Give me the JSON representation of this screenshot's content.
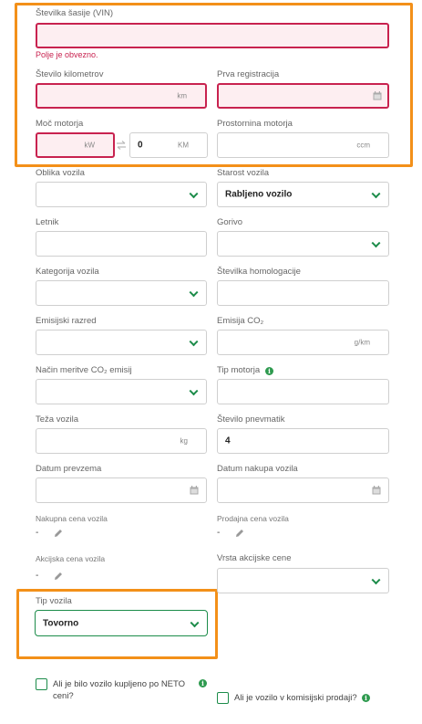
{
  "vin": {
    "label": "Številka šasije (VIN)",
    "value": "",
    "error": "Polje je obvezno."
  },
  "mileage": {
    "label": "Število kilometrov",
    "unit": "km",
    "value": ""
  },
  "first_registration": {
    "label": "Prva registracija",
    "value": ""
  },
  "engine_power": {
    "label": "Moč motorja",
    "unit_kw": "kW",
    "value_kw": "",
    "unit_hp": "KM",
    "value_hp": "0"
  },
  "engine_volume": {
    "label": "Prostornina motorja",
    "unit": "ccm",
    "value": ""
  },
  "body_type": {
    "label": "Oblika vozila",
    "selected": ""
  },
  "vehicle_age": {
    "label": "Starost vozila",
    "selected": "Rabljeno vozilo"
  },
  "model_year": {
    "label": "Letnik",
    "value": ""
  },
  "fuel": {
    "label": "Gorivo",
    "selected": ""
  },
  "vehicle_category": {
    "label": "Kategorija vozila",
    "selected": ""
  },
  "homologation": {
    "label": "Številka homologacije",
    "value": ""
  },
  "emission_class": {
    "label": "Emisijski razred",
    "selected": ""
  },
  "co2_emission": {
    "label": "Emisija CO₂",
    "unit": "g/km",
    "value": ""
  },
  "co2_method": {
    "label": "Način meritve CO₂ emisij",
    "selected": ""
  },
  "engine_type": {
    "label": "Tip motorja",
    "value": ""
  },
  "weight": {
    "label": "Teža vozila",
    "unit": "kg",
    "value": ""
  },
  "tyres": {
    "label": "Število pnevmatik",
    "value": "4"
  },
  "takeover_date": {
    "label": "Datum prevzema",
    "value": ""
  },
  "purchase_date": {
    "label": "Datum nakupa vozila",
    "value": ""
  },
  "purchase_price": {
    "label": "Nakupna cena vozila",
    "value": "-"
  },
  "sale_price": {
    "label": "Prodajna cena vozila",
    "value": "-"
  },
  "promo_price": {
    "label": "Akcijska cena vozila",
    "value": "-"
  },
  "promo_price_type": {
    "label": "Vrsta akcijske cene",
    "selected": ""
  },
  "vehicle_type": {
    "label": "Tip vozila",
    "selected": "Tovorno"
  },
  "neto_purchase": {
    "label": "Ali je bilo vozilo kupljeno po NETO ceni?",
    "line1": "Ali je bilo vozilo kupljeno po NETO",
    "line2": "ceni?",
    "checked": false
  },
  "consignment": {
    "label": "Ali je vozilo v komisijski prodaji?",
    "checked": false
  },
  "info_glyph": "i",
  "colors": {
    "accent": "#1c8c4a",
    "error": "#c8224f",
    "highlight": "#f39019"
  }
}
